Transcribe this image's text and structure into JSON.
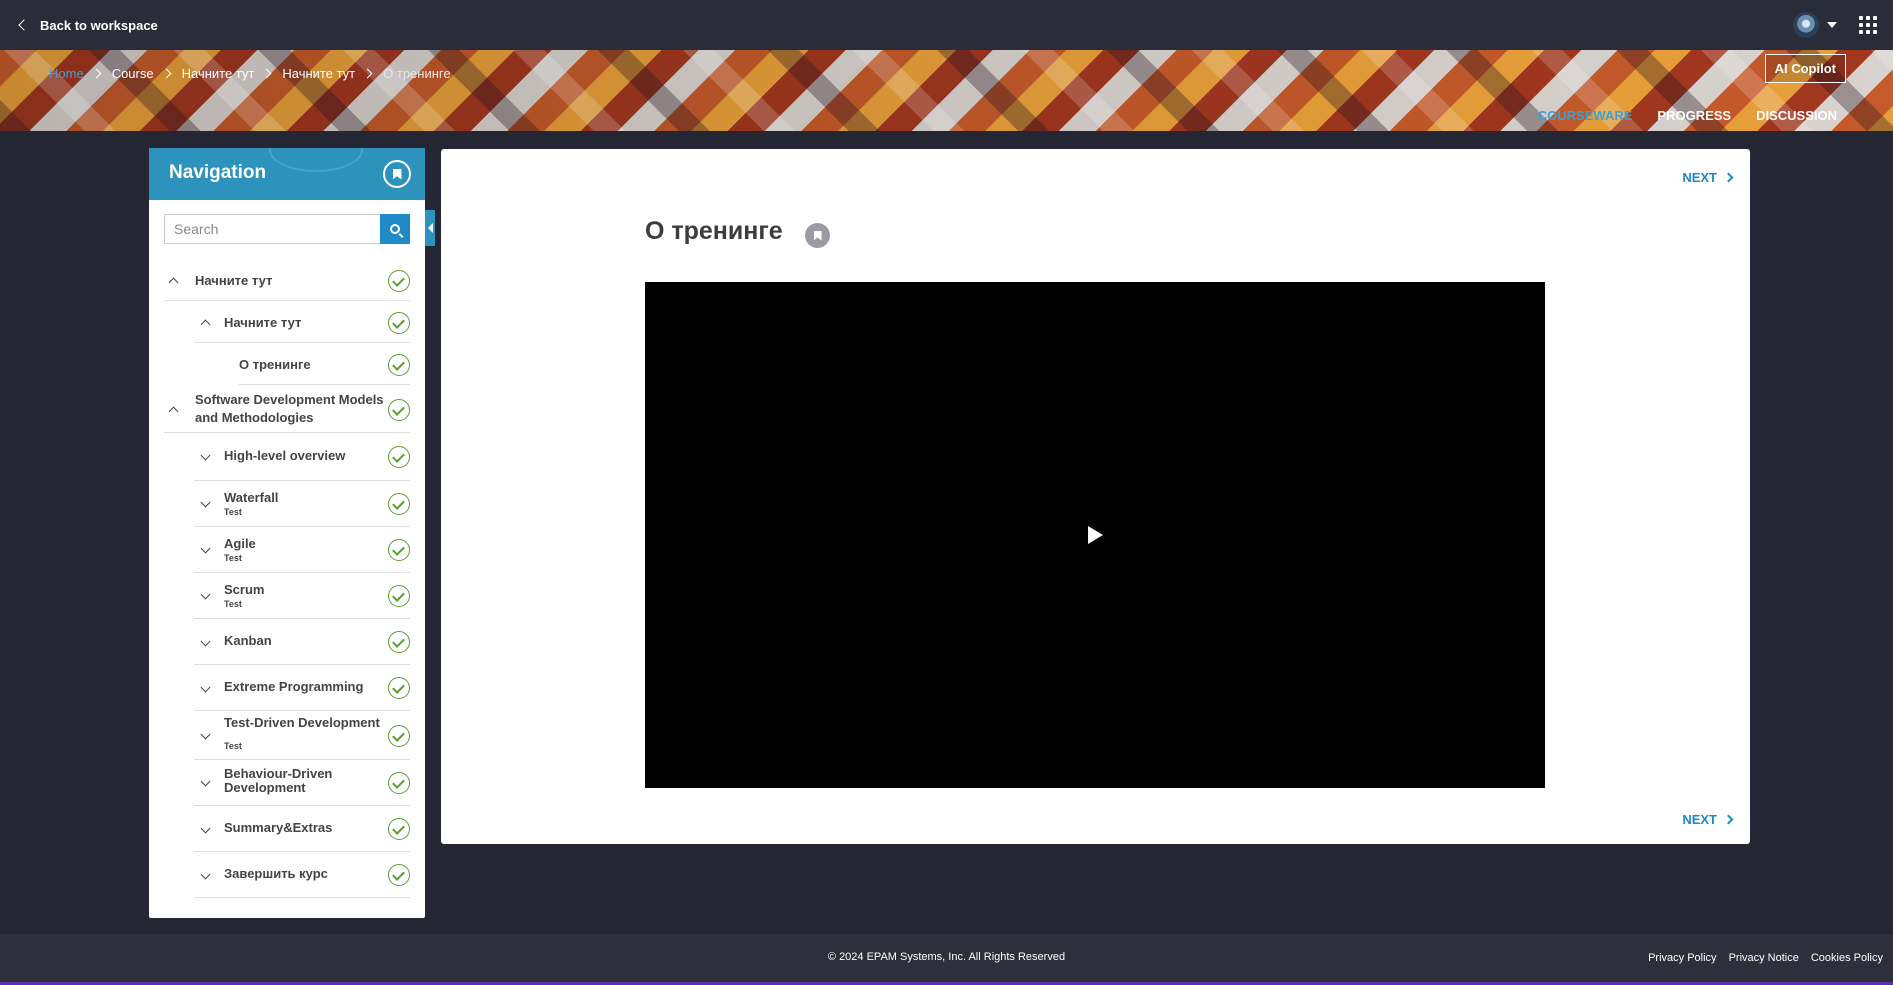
{
  "topbar": {
    "back_label": "Back to workspace"
  },
  "breadcrumbs": [
    "Home",
    "Course",
    "Начните тут",
    "Начните тут",
    "О тренинге"
  ],
  "banner": {
    "copilot_label": "AI Copilot",
    "tabs": [
      "COURSEWARE",
      "PROGRESS",
      "DISCUSSION"
    ]
  },
  "navigation": {
    "title": "Navigation",
    "search_placeholder": "Search",
    "items": [
      {
        "label": "Начните тут",
        "sub": ""
      },
      {
        "label": "Начните тут",
        "sub": ""
      },
      {
        "label": "О тренинге",
        "sub": ""
      },
      {
        "label": "Software Development Models and Methodologies",
        "sub": ""
      },
      {
        "label": "High-level overview",
        "sub": ""
      },
      {
        "label": "Waterfall",
        "sub": "Test"
      },
      {
        "label": "Agile",
        "sub": "Test"
      },
      {
        "label": "Scrum",
        "sub": "Test"
      },
      {
        "label": "Kanban",
        "sub": ""
      },
      {
        "label": "Extreme Programming",
        "sub": ""
      },
      {
        "label": "Test-Driven Development",
        "sub": "Test"
      },
      {
        "label": "Behaviour-Driven Development",
        "sub": ""
      },
      {
        "label": "Summary&Extras",
        "sub": ""
      },
      {
        "label": "Завершить курс",
        "sub": ""
      }
    ]
  },
  "content": {
    "title": "О тренинге",
    "next_label": "NEXT"
  },
  "footer": {
    "copyright": "© 2024 EPAM Systems, Inc. All Rights Reserved",
    "links": [
      "Privacy Policy",
      "Privacy Notice",
      "Cookies Policy"
    ]
  }
}
